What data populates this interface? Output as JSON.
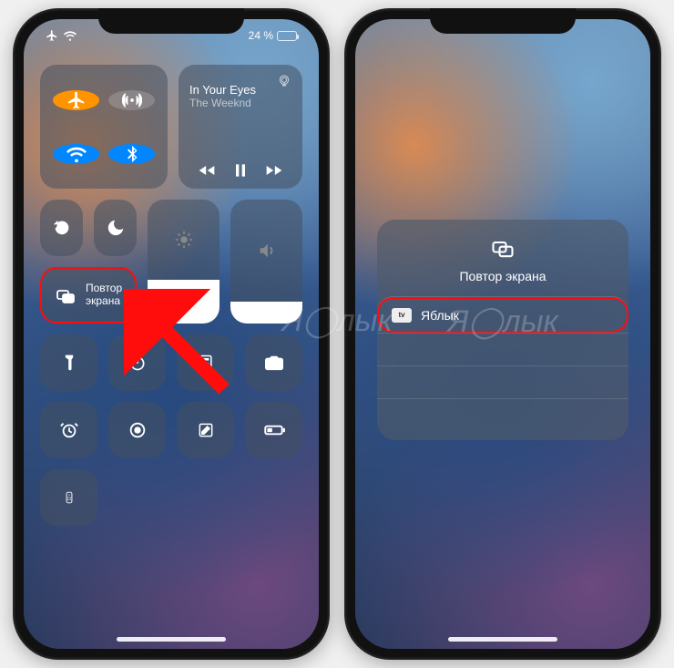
{
  "status": {
    "battery_text": "24 %"
  },
  "music": {
    "title": "In Your Eyes",
    "artist": "The Weeknd"
  },
  "mirror": {
    "label_line1": "Повтор",
    "label_line2": "экрана"
  },
  "right_panel": {
    "title": "Повтор экрана",
    "device": "Яблык"
  },
  "watermark": "Я◯лык",
  "colors": {
    "highlight": "#e11",
    "accent_orange": "#ff9500",
    "accent_blue": "#0a84ff"
  }
}
